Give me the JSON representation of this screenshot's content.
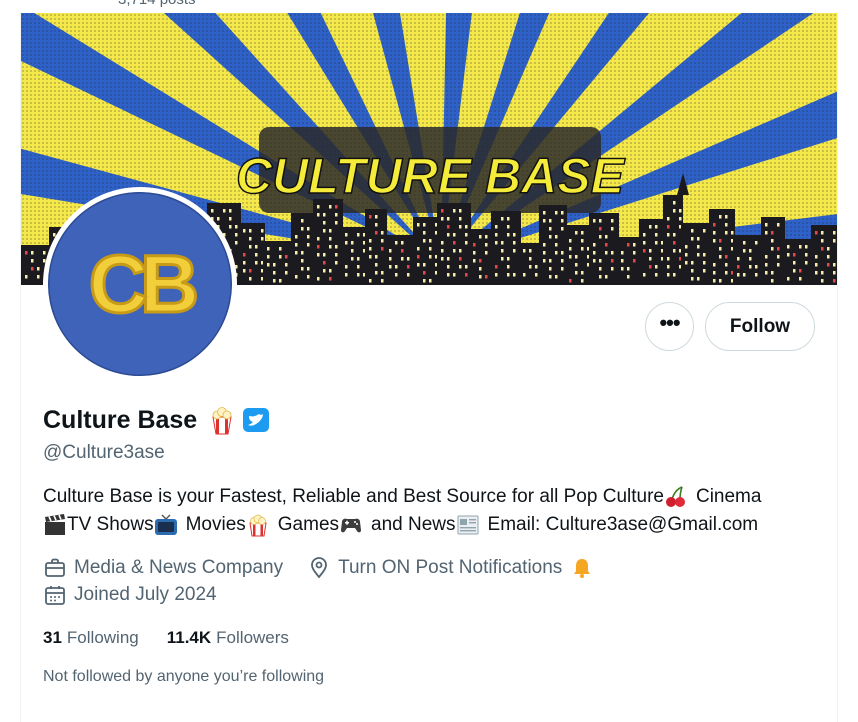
{
  "top": {
    "posts_count_text": "3,714 posts"
  },
  "banner": {
    "title": "CULTURE BASE"
  },
  "avatar": {
    "letters": "CB"
  },
  "actions": {
    "more_label": "•••",
    "follow_label": "Follow"
  },
  "profile": {
    "display_name": "Culture Base",
    "name_emoji": "popcorn-icon",
    "verified_badge": "verified-icon",
    "handle": "@Culture3ase",
    "bio_line1": {
      "text": "Culture Base is your Fastest, Reliable and Best Source for all Pop Culture",
      "cinema": "Cinema"
    },
    "bio_line2": {
      "tv": "TV Shows",
      "movies": "Movies",
      "games": "Games",
      "news": "and News",
      "email": "Email: Culture3ase@Gmail.com"
    },
    "category": "Media & News Company",
    "location": "Turn ON Post Notifications",
    "joined": "Joined July 2024"
  },
  "stats": {
    "following_count": "31",
    "following_label": "Following",
    "followers_count": "11.4K",
    "followers_label": "Followers"
  },
  "social_context": "Not followed by anyone you’re following",
  "colors": {
    "banner_blue": "#2f62c9",
    "banner_yellow": "#f5e84a",
    "avatar_blue": "#3f63b8",
    "logo_gold": "#f2cf3a",
    "verified_blue": "#1d9bf0",
    "muted_text": "#536471"
  }
}
